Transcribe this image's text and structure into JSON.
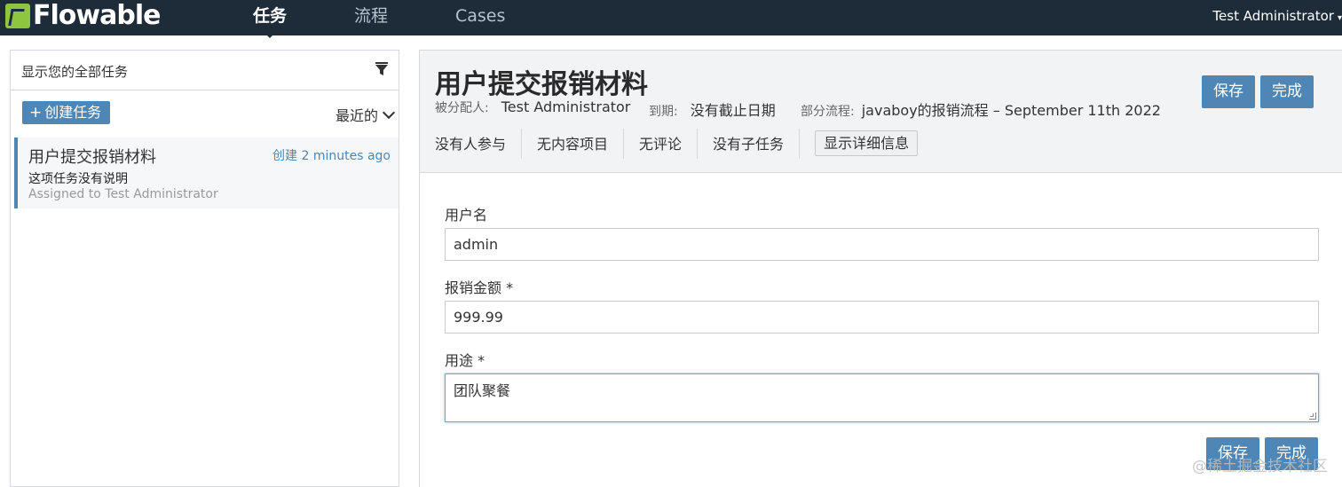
{
  "app": {
    "logo_text": "Flowable",
    "brand_color": "#8fc640",
    "navbar_color": "#1e2c3a",
    "accent_color": "#4e87b5"
  },
  "nav": {
    "tabs": [
      {
        "label": "任务",
        "active": true
      },
      {
        "label": "流程",
        "active": false
      },
      {
        "label": "Cases",
        "active": false
      }
    ],
    "user": "Test Administrator"
  },
  "left": {
    "filter_text": "显示您的全部任务",
    "create_label": "创建任务",
    "sort_label": "最近的",
    "tasks": [
      {
        "title": "用户提交报销材料",
        "created": "创建 2 minutes ago",
        "description": "这项任务没有说明",
        "assigned": "Assigned to Test Administrator"
      }
    ]
  },
  "task": {
    "title": "用户提交报销材料",
    "assignee_label": "被分配人:",
    "assignee": "Test Administrator",
    "due_label": "到期:",
    "due": "没有截止日期",
    "process_label": "部分流程:",
    "process": "javaboy的报销流程 – September 11th 2022",
    "save_label": "保存",
    "complete_label": "完成",
    "tabs": [
      "没有人参与",
      "无内容项目",
      "无评论",
      "没有子任务"
    ],
    "details_label": "显示详细信息"
  },
  "form": {
    "fields": [
      {
        "label": "用户名",
        "value": "admin"
      },
      {
        "label": "报销金额 *",
        "value": "999.99"
      },
      {
        "label": "用途 *",
        "value": "团队聚餐"
      }
    ],
    "save_label": "保存",
    "complete_label": "完成"
  },
  "watermark": "@稀土掘金技术社区"
}
